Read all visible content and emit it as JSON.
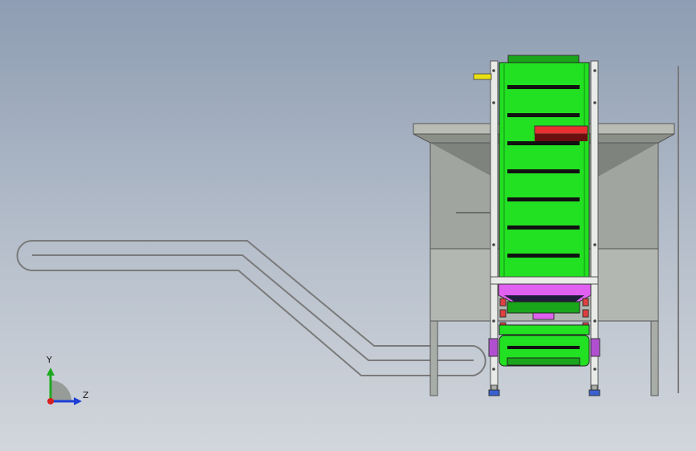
{
  "viewport": {
    "background_top": "#8e9db3",
    "background_bottom": "#d2d6dc"
  },
  "triad": {
    "y_label": "Y",
    "z_label": "Z",
    "y_color": "#1ea81e",
    "z_color": "#1e3fd6",
    "x_color": "#d81e1e"
  },
  "model": {
    "belt_color": "#22e022",
    "cleat_color": "#111111",
    "hopper_color": "#e060f0",
    "red_block_color": "#e83030",
    "frame_color": "#a9ada7",
    "rail_color": "#e8ebe8",
    "handle_color": "#e8e010"
  }
}
